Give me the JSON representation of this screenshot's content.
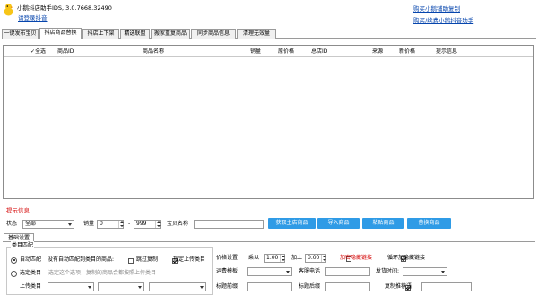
{
  "app": {
    "title": "小鹅抖店助手IDS, 3.0.7668.32490",
    "login_link": "请登录抖音",
    "buy_copy_link": "购买小鹅铺助复制",
    "buy_renew_link": "购买/续费小鹅抖音助手"
  },
  "tabs": [
    {
      "label": "一键发布宝贝"
    },
    {
      "label": "抖店商品替换"
    },
    {
      "label": "抖店上下架"
    },
    {
      "label": "精选联盟"
    },
    {
      "label": "搬家重复商品"
    },
    {
      "label": "同步商品信息"
    },
    {
      "label": "清理无效量"
    }
  ],
  "grid": {
    "columns": [
      {
        "label": "全选"
      },
      {
        "label": "商品ID"
      },
      {
        "label": "商品名称"
      },
      {
        "label": "销量"
      },
      {
        "label": "原价格"
      },
      {
        "label": "总店ID"
      },
      {
        "label": "来源"
      },
      {
        "label": "新价格"
      },
      {
        "label": "提示信息"
      }
    ]
  },
  "hint_label": "提示信息",
  "filter": {
    "status_label": "状态",
    "status_value": "全部",
    "sales_label": "销量",
    "sales_min": "0",
    "sales_sep": "-",
    "sales_max": "999",
    "name_label": "宝贝名称",
    "name_value": ""
  },
  "buttons": {
    "get_main": "获取主店商品",
    "import": "导入商品",
    "paste": "粘贴商品",
    "replace": "替换商品"
  },
  "settings": {
    "tab_label": "基础设置",
    "category_group": "类目匹配",
    "auto_match_label": "自动匹配",
    "no_match_label": "没有自动匹配到类目的商品:",
    "skip_copy_label": "跳过复制",
    "assign_category_label": "指定上传类目",
    "select_category_label": "选定类目",
    "select_category_hint": "选定这个选项，复制的商品会都按照上传类目",
    "upload_category_label": "上传类目",
    "price_label": "价格设置",
    "multiply_label": "乘以",
    "multiply_value": "1.00",
    "add_label": "加上",
    "add_value": "0.00",
    "add_watermark_label": "加密隐藏链接",
    "auto_hidden_label": "循环加隐藏链接",
    "freight_label": "运费模板",
    "service_phone_label": "客服电话",
    "ship_time_label": "发货时间:",
    "title_prefix_label": "标题前缀",
    "title_suffix_label": "标题后缀",
    "copy_comment_label": "复制推荐语"
  }
}
